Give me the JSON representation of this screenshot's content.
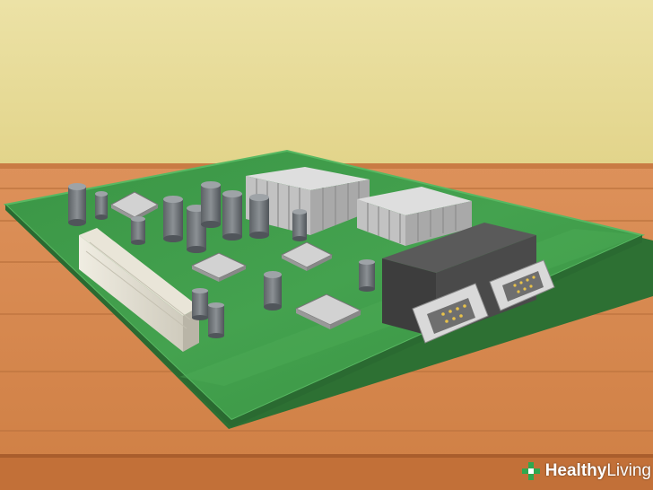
{
  "scene": {
    "subject": "motherboard-on-wooden-table",
    "colors": {
      "wall": "#e8dc98",
      "table": "#d98a4e",
      "table_edge": "#b8693a",
      "board": "#3f9a4a",
      "board_edge": "#2c6f34",
      "chips": "#8e8e8e",
      "heatsink": "#c9c9c9",
      "port_block": "#444444"
    }
  },
  "watermark": {
    "brand_bold": "Healthy",
    "brand_light": "Living",
    "icon": "green-cross-icon"
  }
}
